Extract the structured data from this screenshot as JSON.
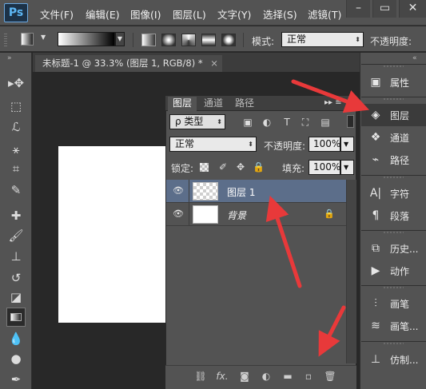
{
  "app": {
    "logo": "Ps"
  },
  "menu": [
    "文件(F)",
    "编辑(E)",
    "图像(I)",
    "图层(L)",
    "文字(Y)",
    "选择(S)",
    "滤镜(T)"
  ],
  "window_controls": {
    "minimize": "–",
    "restore": "▭",
    "close": "✕"
  },
  "options_bar": {
    "mode_label": "模式:",
    "mode_value": "正常",
    "opacity_label": "不透明度:"
  },
  "document": {
    "tab_title": "未标题-1 @ 33.3% (图层 1, RGB/8) *",
    "tab_close": "×",
    "collapse_left": "»",
    "collapse_right": "«"
  },
  "layers_panel": {
    "tabs": [
      "图层",
      "通道",
      "路径"
    ],
    "menu_glyph": "▸▸ ≡",
    "filter": {
      "label": "ρ 类型"
    },
    "blend_mode": "正常",
    "opacity_label": "不透明度:",
    "opacity_value": "100%",
    "lock_label": "锁定:",
    "fill_label": "填充:",
    "fill_value": "100%",
    "layers": [
      {
        "name": "图层 1",
        "selected": true,
        "thumb": "transparent",
        "locked": false
      },
      {
        "name": "背景",
        "selected": false,
        "thumb": "white",
        "locked": true
      }
    ],
    "footer_icons": [
      "link-icon",
      "fx-icon",
      "mask-icon",
      "adjustment-icon",
      "group-icon",
      "new-layer-icon",
      "trash-icon"
    ]
  },
  "dock": {
    "items": [
      {
        "label": "属性",
        "icon": "properties-icon",
        "active": false
      },
      {
        "label": "图层",
        "icon": "layers-icon",
        "active": true
      },
      {
        "label": "通道",
        "icon": "channels-icon",
        "active": false
      },
      {
        "label": "路径",
        "icon": "paths-icon",
        "active": false
      },
      {
        "label": "字符",
        "icon": "character-icon",
        "active": false
      },
      {
        "label": "段落",
        "icon": "paragraph-icon",
        "active": false
      },
      {
        "label": "历史...",
        "icon": "history-icon",
        "active": false
      },
      {
        "label": "动作",
        "icon": "actions-icon",
        "active": false
      },
      {
        "label": "画笔",
        "icon": "brush-presets-icon",
        "active": false
      },
      {
        "label": "画笔...",
        "icon": "brush-icon",
        "active": false
      },
      {
        "label": "仿制...",
        "icon": "clone-source-icon",
        "active": false
      }
    ]
  },
  "colors": {
    "annotation_arrow": "#e8393a",
    "selected_layer": "#5c6e8a",
    "ui_panel": "#535353"
  }
}
